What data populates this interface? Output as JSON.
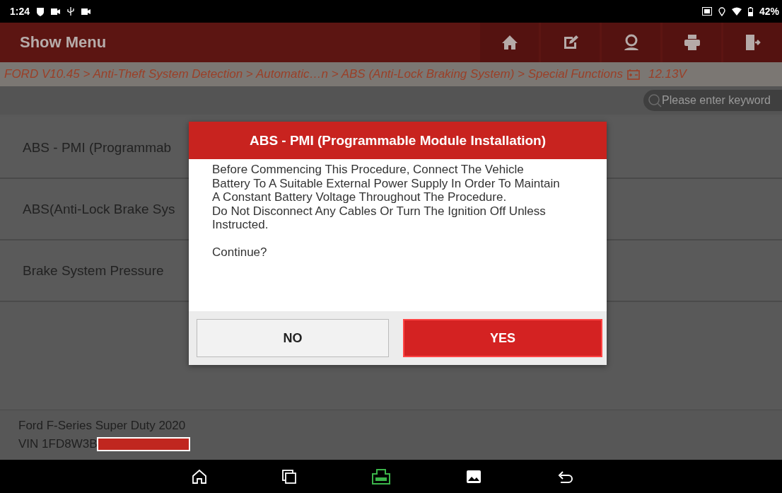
{
  "status_bar": {
    "time": "1:24",
    "battery": "42%"
  },
  "header": {
    "title": "Show Menu"
  },
  "breadcrumb": {
    "path": "FORD V10.45 > Anti-Theft System Detection > Automatic…n > ABS (Anti-Lock Braking System) > Special Functions",
    "voltage": "12.13V"
  },
  "search": {
    "placeholder": "Please enter keyword"
  },
  "menu_items": [
    {
      "label": "ABS - PMI (Programmab"
    },
    {
      "label": "ABS(Anti-Lock Brake Sys"
    },
    {
      "label": "Brake System Pressure"
    }
  ],
  "footer": {
    "vehicle": "Ford F-Series Super Duty 2020",
    "vin": "VIN 1FD8W3B"
  },
  "dialog": {
    "title": "ABS - PMI (Programmable Module Installation)",
    "message": [
      "Before Commencing This Procedure, Connect The Vehicle Battery To A Suitable External Power Supply In Order To Maintain A Constant Battery Voltage Throughout The Procedure.",
      "Do Not Disconnect Any Cables Or Turn The Ignition Off Unless Instructed."
    ],
    "prompt": "Continue?",
    "buttons": [
      {
        "label": "NO",
        "selected": false
      },
      {
        "label": "YES",
        "selected": true
      }
    ]
  }
}
